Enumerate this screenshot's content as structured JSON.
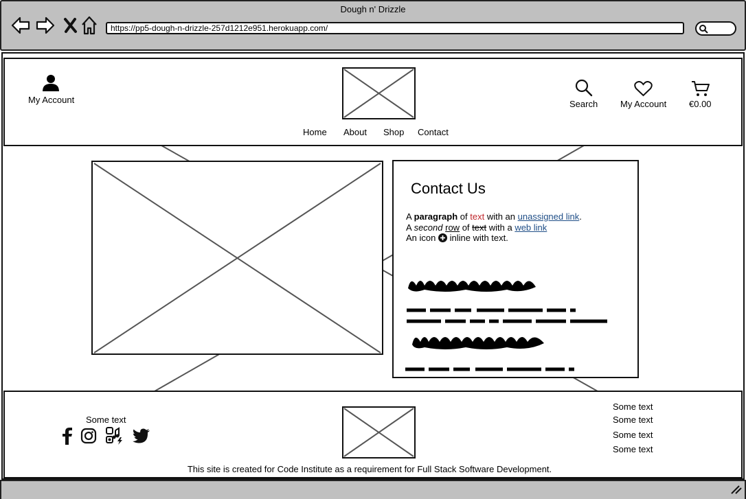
{
  "window": {
    "title": "Dough n' Drizzle",
    "url": "https://pp5-dough-n-drizzle-257d1212e951.herokuapp.com/"
  },
  "header": {
    "left_account_label": "My Account",
    "search_label": "Search",
    "wishlist_label": "My Account",
    "cart_total": "€0.00",
    "nav": [
      "Home",
      "About",
      "Shop",
      "Contact"
    ]
  },
  "contact": {
    "title": "Contact Us",
    "line1": {
      "a": "A ",
      "bold": "paragraph",
      "of": " of ",
      "red": "text",
      "with": " with an ",
      "link": "unassigned link",
      "end": "."
    },
    "line2": {
      "a": "A ",
      "italic": "second",
      "sp": " ",
      "underline": "row",
      "of": " of ",
      "strike": "text",
      "with": " with a ",
      "link": "web link"
    },
    "line3": {
      "a": "An icon ",
      "b": " inline with text."
    }
  },
  "footer": {
    "social_heading": "Some text",
    "links": [
      "Some text",
      "Some text",
      "Some text",
      "Some text"
    ],
    "note": "This site is created for Code Institute as a requirement for Full Stack Software Development."
  },
  "icons": [
    "back-icon",
    "forward-icon",
    "stop-icon",
    "home-icon",
    "user-icon",
    "search-icon",
    "heart-icon",
    "cart-icon",
    "facebook-icon",
    "instagram-icon",
    "tiktok-icon",
    "twitter-icon",
    "add-circle-icon",
    "resize-grip-icon"
  ]
}
